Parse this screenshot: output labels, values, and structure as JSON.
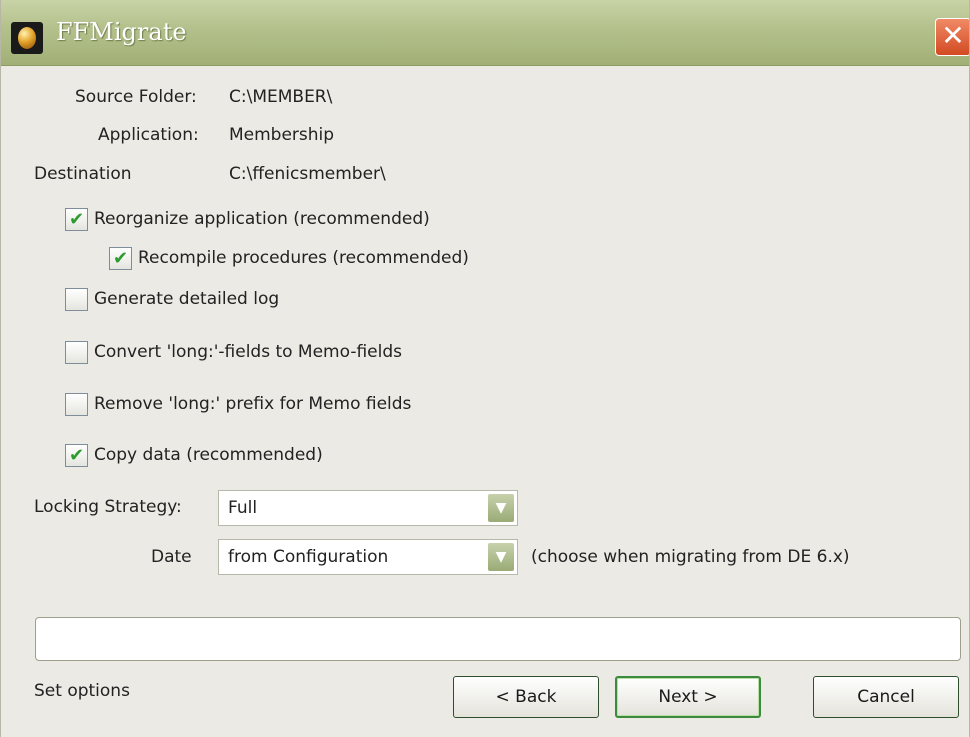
{
  "window": {
    "title": "FFMigrate",
    "close_glyph": "✕"
  },
  "info": {
    "source_label": "Source Folder:",
    "source_value": "C:\\MEMBER\\",
    "application_label": "Application:",
    "application_value": "Membership",
    "destination_label": "Destination",
    "destination_value": "C:\\ffenicsmember\\"
  },
  "options": {
    "reorganize": {
      "label": "Reorganize application (recommended)",
      "checked": true
    },
    "recompile": {
      "label": "Recompile procedures (recommended)",
      "checked": true
    },
    "detailed_log": {
      "label": "Generate detailed log",
      "checked": false
    },
    "convert_long": {
      "label": "Convert 'long:'-fields to Memo-fields",
      "checked": false
    },
    "remove_prefix": {
      "label": "Remove 'long:' prefix for Memo fields",
      "checked": false
    },
    "copy_data": {
      "label": "Copy data (recommended)",
      "checked": true
    }
  },
  "locking": {
    "label": "Locking Strategy:",
    "value": "Full"
  },
  "date": {
    "label": "Date",
    "value": "from Configuration",
    "hint": "(choose when migrating from DE 6.x)"
  },
  "status_text": "Set options",
  "progress": 0,
  "buttons": {
    "back": "< Back",
    "next": "Next >",
    "cancel": "Cancel"
  },
  "icons": {
    "check": "✔",
    "dropdown": "▼"
  },
  "colors": {
    "titlebar": "#b3c08b",
    "check": "#2e9b2e",
    "close": "#d24a22"
  }
}
